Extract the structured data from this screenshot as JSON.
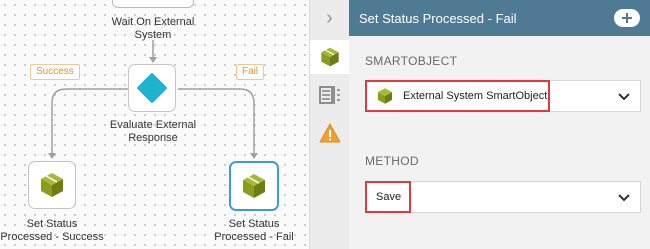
{
  "canvas": {
    "top_node_label": "Wait On External\nSystem",
    "branch_success": "Success",
    "branch_fail": "Fail",
    "evaluate_label": "Evaluate External\nResponse",
    "success_node_label": "Set Status\nProcessed - Success",
    "fail_node_label": "Set Status\nProcessed - Fail"
  },
  "panel": {
    "title": "Set Status Processed - Fail",
    "smartobject_label": "SMARTOBJECT",
    "smartobject_value": "External System SmartObject",
    "method_label": "METHOD",
    "method_value": "Save"
  },
  "icons": {
    "collapse": "chevron-right-icon",
    "tab1": "smartobject-cube-icon",
    "tab2": "data-mapping-icon",
    "tab3": "warning-icon",
    "header_button": "add-icon",
    "dropdown": "chevron-down-icon"
  },
  "colors": {
    "header": "#4f7a94",
    "cube": "#8c9c1c",
    "diamond": "#20b3cf",
    "branch": "#e0922f",
    "selected": "#3c9be0",
    "highlight": "#e0393e",
    "warning": "#f0a030"
  }
}
